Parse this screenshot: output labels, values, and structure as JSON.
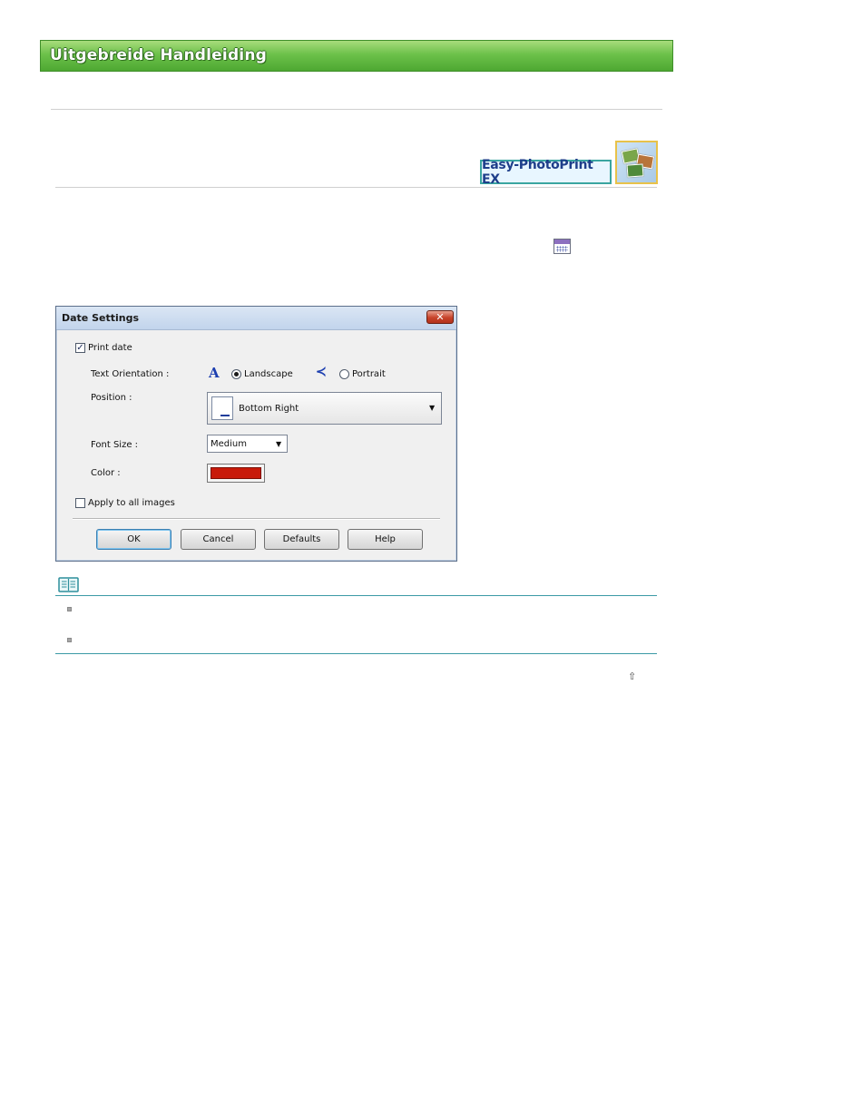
{
  "header": {
    "banner_title": "Uitgebreide Handleiding"
  },
  "product": {
    "logo_text": "Easy-PhotoPrint EX"
  },
  "dialog": {
    "title": "Date Settings",
    "close_glyph": "✕",
    "print_date": {
      "label": "Print date",
      "checked": true,
      "check_glyph": "✓"
    },
    "text_orientation": {
      "label": "Text Orientation :",
      "landscape_label": "Landscape",
      "landscape_glyph": "A",
      "portrait_label": "Portrait",
      "portrait_glyph": "≺",
      "selected": "Landscape"
    },
    "position": {
      "label": "Position :",
      "value": "Bottom Right"
    },
    "font_size": {
      "label": "Font Size :",
      "value": "Medium"
    },
    "color": {
      "label": "Color :",
      "value": "#c81a0a"
    },
    "apply_all": {
      "label": "Apply to all images",
      "checked": false
    },
    "buttons": {
      "ok": "OK",
      "cancel": "Cancel",
      "defaults": "Defaults",
      "help": "Help"
    },
    "dropdown_glyph": "▼"
  },
  "footer": {
    "top_link_glyph": "⇧"
  },
  "colors": {
    "banner_green": "#6cc14a",
    "note_rule": "#3c9aa6",
    "logo_border": "#3aa5a0",
    "photo_border": "#e8c24a"
  }
}
